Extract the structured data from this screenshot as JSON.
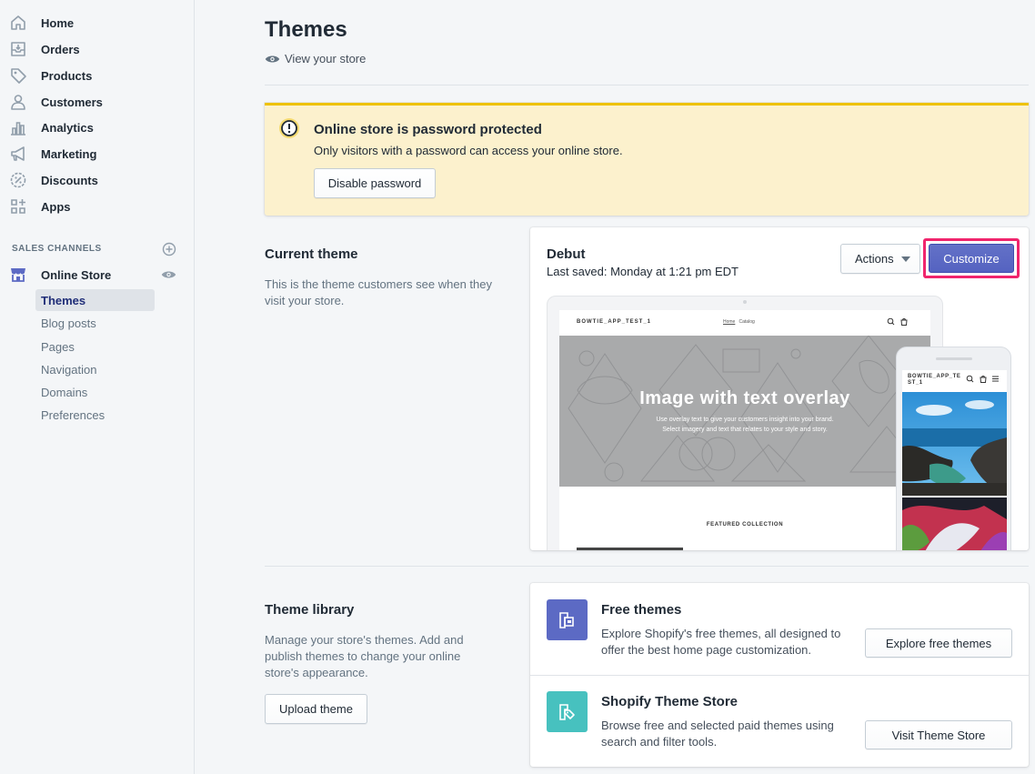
{
  "sidebar": {
    "items": [
      {
        "label": "Home",
        "icon": "home-icon"
      },
      {
        "label": "Orders",
        "icon": "orders-icon"
      },
      {
        "label": "Products",
        "icon": "tag-icon"
      },
      {
        "label": "Customers",
        "icon": "person-icon"
      },
      {
        "label": "Analytics",
        "icon": "bar-chart-icon"
      },
      {
        "label": "Marketing",
        "icon": "megaphone-icon"
      },
      {
        "label": "Discounts",
        "icon": "discount-icon"
      },
      {
        "label": "Apps",
        "icon": "apps-icon"
      }
    ],
    "channels_title": "SALES CHANNELS",
    "online_store": {
      "label": "Online Store",
      "sub_items": [
        "Themes",
        "Blog posts",
        "Pages",
        "Navigation",
        "Domains",
        "Preferences"
      ],
      "active": "Themes"
    }
  },
  "header": {
    "title": "Themes",
    "view_store": "View your store"
  },
  "banner": {
    "title": "Online store is password protected",
    "text": "Only visitors with a password can access your online store.",
    "button": "Disable password"
  },
  "current_theme": {
    "heading": "Current theme",
    "description": "This is the theme customers see when they visit your store.",
    "theme_name": "Debut",
    "last_saved": "Last saved: Monday at 1:21 pm EDT",
    "actions_label": "Actions",
    "customize_label": "Customize",
    "preview": {
      "store_name": "BOWTIE_APP_TEST_1",
      "nav_home": "Home",
      "nav_catalog": "Catalog",
      "hero_title": "Image with text overlay",
      "hero_line1": "Use overlay text to give your customers insight into your brand.",
      "hero_line2": "Select imagery and text that relates to your style and story.",
      "featured": "FEATURED COLLECTION",
      "phone_store_name": "BOWTIE_APP_TE ST_1"
    }
  },
  "theme_library": {
    "heading": "Theme library",
    "description": "Manage your store's themes. Add and publish themes to change your online store's appearance.",
    "upload_button": "Upload theme",
    "free_themes": {
      "title": "Free themes",
      "text": "Explore Shopify's free themes, all designed to offer the best home page customization.",
      "button": "Explore free themes"
    },
    "theme_store": {
      "title": "Shopify Theme Store",
      "text": "Browse free and selected paid themes using search and filter tools.",
      "button": "Visit Theme Store"
    }
  },
  "colors": {
    "accent": "#5c6ac4",
    "highlight": "#f0256d",
    "banner_bg": "#fcf1cd",
    "banner_border": "#eec200",
    "free_themes_icon_bg": "#5c6ac4",
    "theme_store_icon_bg": "#47c1bf"
  }
}
